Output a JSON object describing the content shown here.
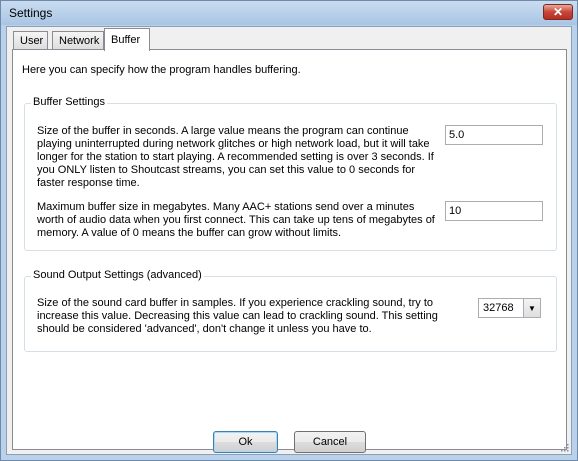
{
  "window": {
    "title": "Settings",
    "close_glyph": "✕",
    "close_icon": "close-icon"
  },
  "tabs": [
    {
      "label": "User",
      "active": false
    },
    {
      "label": "Network",
      "active": false
    },
    {
      "label": "Buffer",
      "active": true
    }
  ],
  "buffer": {
    "intro": "Here you can specify how the program handles buffering.",
    "buffer_settings": {
      "legend": "Buffer Settings",
      "buffer_seconds": {
        "lines": [
          "Size of the buffer in seconds. A large value means the program can continue",
          "playing uninterrupted during network glitches or high network load, but it will take",
          "longer for the station to start playing. A recommended setting is over 3 seconds. If",
          "you ONLY listen to Shoutcast streams, you can set this value to 0 seconds for",
          "faster response time."
        ],
        "value": "5.0"
      },
      "max_buffer": {
        "lines": [
          "Maximum buffer size in megabytes. Many AAC+ stations send over a minutes",
          "worth of audio data when you first connect. This can take up tens of megabytes of",
          "memory. A value of 0 means the buffer can grow without limits."
        ],
        "value": "10"
      }
    },
    "sound_output": {
      "legend": "Sound Output Settings (advanced)",
      "lines": [
        "Size of the sound card buffer in samples. If you experience crackling sound, try to",
        "increase this value. Decreasing this value can lead to crackling sound. This setting",
        "should be considered 'advanced', don't change it unless you have to."
      ],
      "selected": "32768",
      "arrow_glyph": "▼"
    }
  },
  "buttons": {
    "ok": "Ok",
    "cancel": "Cancel"
  },
  "colors": {
    "title_bar": "#b9d1ea",
    "close_button": "#c8453a",
    "panel": "#ffffff",
    "dialog_bg": "#f0f0f0"
  }
}
